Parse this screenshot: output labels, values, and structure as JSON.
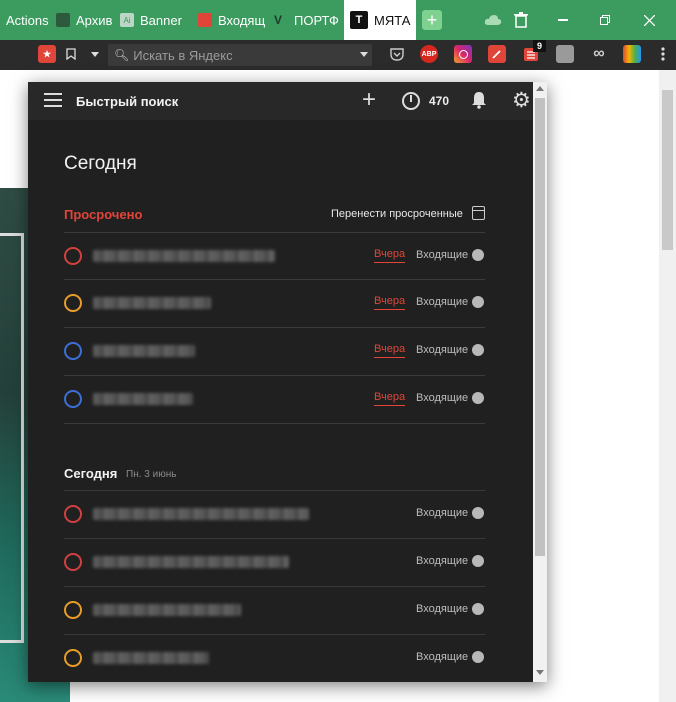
{
  "colors": {
    "tabbar": "#3c9b5f",
    "overdue": "#e0453a",
    "priority_red": "#d04040",
    "priority_orange": "#e89c2a",
    "priority_blue": "#3b6fd6"
  },
  "tabs": [
    {
      "label": "Actions",
      "icon": "none"
    },
    {
      "label": "Архив",
      "icon": "image-icon"
    },
    {
      "label": "Banner",
      "icon": "illustrator-icon"
    },
    {
      "label": "Входящ",
      "icon": "todoist-icon"
    },
    {
      "label": "ПОРТФ",
      "icon": "v-logo-icon"
    },
    {
      "label": "МЯТА",
      "icon": "t-logo-icon"
    }
  ],
  "browser": {
    "search_placeholder": "Искать в Яндекс",
    "badge_count": "9",
    "abp_label": "ABP"
  },
  "popup": {
    "quick_search": "Быстрый поиск",
    "karma": "470",
    "view_title": "Сегодня",
    "overdue_section": "Просрочено",
    "reschedule_label": "Перенести просроченные",
    "today_section": "Сегодня",
    "today_date": "Пн. 3 июнь"
  },
  "overdue_tasks": [
    {
      "priority": "red",
      "date": "Вчера",
      "project": "Входящие"
    },
    {
      "priority": "orange",
      "date": "Вчера",
      "project": "Входящие"
    },
    {
      "priority": "blue",
      "date": "Вчера",
      "project": "Входящие"
    },
    {
      "priority": "blue",
      "date": "Вчера",
      "project": "Входящие"
    }
  ],
  "today_tasks": [
    {
      "priority": "red",
      "project": "Входящие"
    },
    {
      "priority": "red",
      "project": "Входящие"
    },
    {
      "priority": "orange",
      "project": "Входящие"
    },
    {
      "priority": "orange",
      "project": "Входящие"
    }
  ]
}
